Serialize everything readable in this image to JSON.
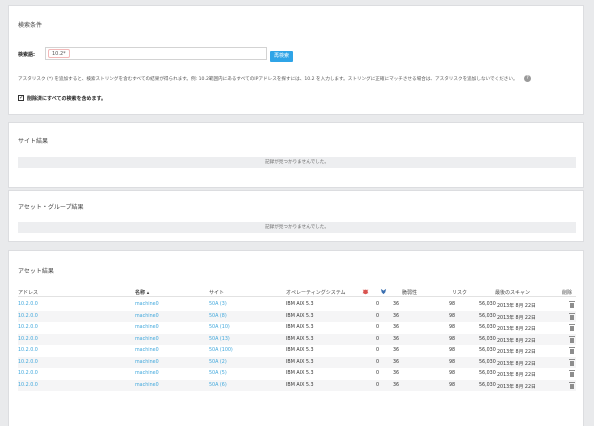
{
  "search": {
    "title": "検索条件",
    "field_label": "検索語:",
    "query_value": "10.2*",
    "search_button": "再検索",
    "hint": "アスタリスク (*) を追加すると、検索ストリングを含むすべての結果が得られます。例: 10.2範囲内にあるすべてのIPアドレスを探すには、10.2 を入力します。ストリングに正確にマッチさせる場合は、アスタリスクを追加しないでください。",
    "checkbox_label": "削除済にすべての検索を含めます。"
  },
  "site_results": {
    "title": "サイト結果",
    "empty": "記録が見つかりませんでした。"
  },
  "group_results": {
    "title": "アセット・グループ結果",
    "empty": "記録が見つかりませんでした。"
  },
  "asset_results": {
    "title": "アセット結果",
    "columns": {
      "address": "アドレス",
      "name": "名称 ▴",
      "site": "サイト",
      "os": "オペレーティングシステム",
      "vuln": "脆弱性",
      "risk": "リスク",
      "last_scan": "最後のスキャン",
      "delete": "削除"
    },
    "header_icons": [
      "malware-icon",
      "exploit-icon"
    ],
    "rows": [
      {
        "address": "10.2.0.0",
        "name": "machine0",
        "site": "50A (3)",
        "os": "IBM AIX 5.3",
        "malware": "0",
        "exploit": "36",
        "vuln": "98",
        "risk": "56,030",
        "last_scan": "2013年 8月 22日"
      },
      {
        "address": "10.2.0.0",
        "name": "machine0",
        "site": "50A (8)",
        "os": "IBM AIX 5.3",
        "malware": "0",
        "exploit": "36",
        "vuln": "98",
        "risk": "56,030",
        "last_scan": "2013年 8月 22日"
      },
      {
        "address": "10.2.0.0",
        "name": "machine0",
        "site": "50A (10)",
        "os": "IBM AIX 5.3",
        "malware": "0",
        "exploit": "36",
        "vuln": "98",
        "risk": "56,030",
        "last_scan": "2013年 8月 22日"
      },
      {
        "address": "10.2.0.0",
        "name": "machine0",
        "site": "50A (13)",
        "os": "IBM AIX 5.3",
        "malware": "0",
        "exploit": "36",
        "vuln": "98",
        "risk": "56,030",
        "last_scan": "2013年 8月 22日"
      },
      {
        "address": "10.2.0.0",
        "name": "machine0",
        "site": "50A (100)",
        "os": "IBM AIX 5.3",
        "malware": "0",
        "exploit": "36",
        "vuln": "98",
        "risk": "56,030",
        "last_scan": "2013年 8月 22日"
      },
      {
        "address": "10.2.0.0",
        "name": "machine0",
        "site": "50A (2)",
        "os": "IBM AIX 5.3",
        "malware": "0",
        "exploit": "36",
        "vuln": "98",
        "risk": "56,030",
        "last_scan": "2013年 8月 22日"
      },
      {
        "address": "10.2.0.0",
        "name": "machine0",
        "site": "50A (5)",
        "os": "IBM AIX 5.3",
        "malware": "0",
        "exploit": "36",
        "vuln": "98",
        "risk": "56,030",
        "last_scan": "2013年 8月 22日"
      },
      {
        "address": "10.2.0.0",
        "name": "machine0",
        "site": "50A (6)",
        "os": "IBM AIX 5.3",
        "malware": "0",
        "exploit": "36",
        "vuln": "98",
        "risk": "56,030",
        "last_scan": "2013年 8月 22日"
      }
    ]
  },
  "colors": {
    "link": "#3fa7dc",
    "button": "#2fa4e7",
    "malware_icon": "#d9534f",
    "exploit_icon": "#3a6fb0"
  }
}
